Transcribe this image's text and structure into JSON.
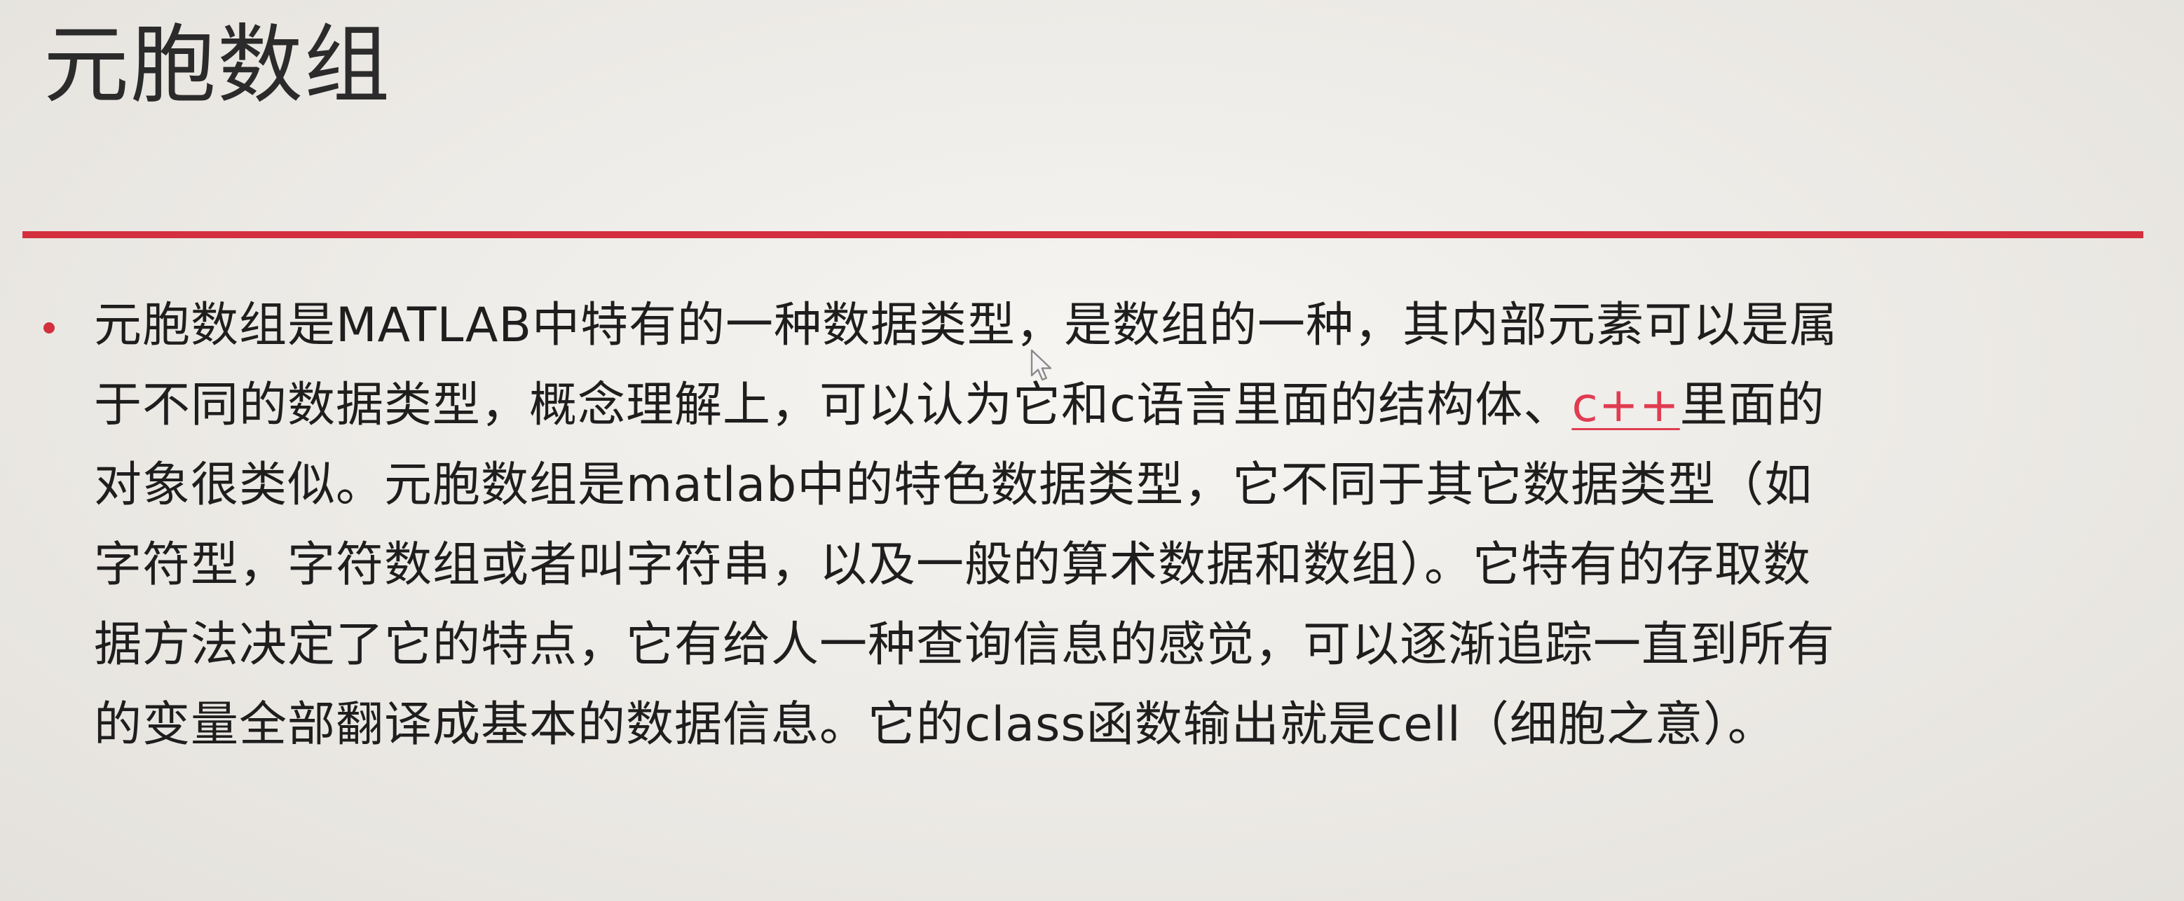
{
  "slide": {
    "title": "元胞数组",
    "accent_color": "#d32f3f",
    "flag_color": "#e03c50",
    "bullet": {
      "lines": {
        "l1": "元胞数组是MATLAB中特有的一种数据类型，是数组的一种，其内部元素可以是属",
        "l2_before": "于不同的数据类型，概念理解上，可以认为它和c语言里面的结构体、",
        "l2_flagged": "c++",
        "l2_after": "里面的",
        "l3": "对象很类似。元胞数组是matlab中的特色数据类型，它不同于其它数据类型（如",
        "l4": "字符型，字符数组或者叫字符串，以及一般的算术数据和数组）。它特有的存取数",
        "l5": "据方法决定了它的特点，它有给人一种查询信息的感觉，可以逐渐追踪一直到所有",
        "l6": "的变量全部翻译成基本的数据信息。它的class函数输出就是cell（细胞之意）。"
      }
    }
  },
  "icons": {
    "bullet": "bullet-dot-icon",
    "cursor": "mouse-cursor-icon"
  }
}
